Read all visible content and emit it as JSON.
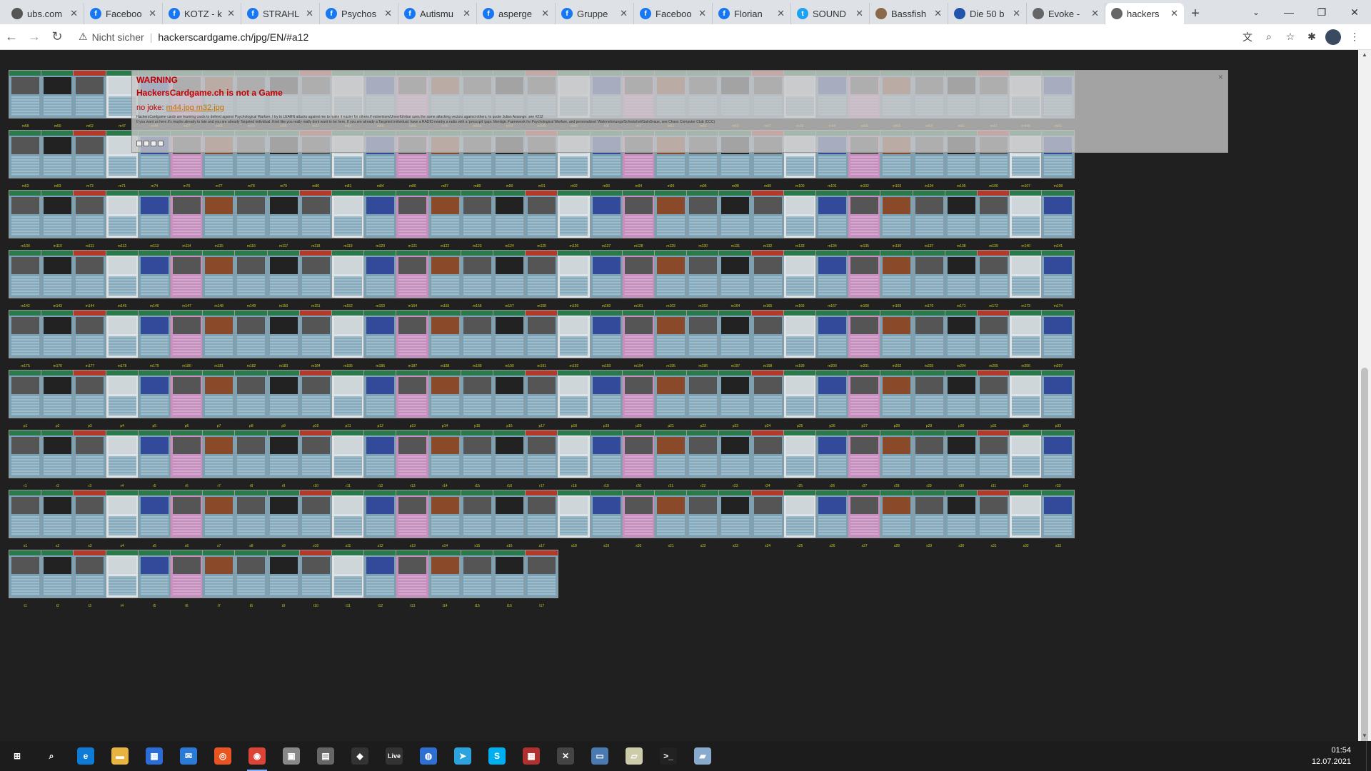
{
  "browser": {
    "tabs": [
      {
        "title": "ubs.com",
        "icon": "ubs-icon",
        "color": "#555555",
        "active": false
      },
      {
        "title": "Faceboo",
        "icon": "facebook-icon",
        "color": "#1877f2",
        "active": false
      },
      {
        "title": "KOTZ - k",
        "icon": "facebook-icon",
        "color": "#1877f2",
        "active": false
      },
      {
        "title": "STRAHL",
        "icon": "facebook-icon",
        "color": "#1877f2",
        "active": false
      },
      {
        "title": "Psychos",
        "icon": "facebook-icon",
        "color": "#1877f2",
        "active": false
      },
      {
        "title": "Autismu",
        "icon": "facebook-icon",
        "color": "#1877f2",
        "active": false
      },
      {
        "title": "asperge",
        "icon": "facebook-icon",
        "color": "#1877f2",
        "active": false
      },
      {
        "title": "Gruppe",
        "icon": "facebook-icon",
        "color": "#1877f2",
        "active": false
      },
      {
        "title": "Faceboo",
        "icon": "facebook-icon",
        "color": "#1877f2",
        "active": false
      },
      {
        "title": "Florian",
        "icon": "facebook-icon",
        "color": "#1877f2",
        "active": false
      },
      {
        "title": "SOUND",
        "icon": "twitter-icon",
        "color": "#1da1f2",
        "active": false
      },
      {
        "title": "Bassfish",
        "icon": "page-icon",
        "color": "#8a6a4a",
        "active": false
      },
      {
        "title": "Die 50 b",
        "icon": "page-icon",
        "color": "#2255aa",
        "active": false
      },
      {
        "title": "Evoke -",
        "icon": "globe-icon",
        "color": "#666666",
        "active": false
      },
      {
        "title": "hackers",
        "icon": "globe-icon",
        "color": "#666666",
        "active": true
      }
    ],
    "new_tab": "+",
    "window_controls": {
      "minimize": "—",
      "maximize": "❐",
      "close": "✕"
    },
    "nav": {
      "back": "←",
      "forward": "→",
      "reload": "↻"
    },
    "address": {
      "security_label": "Nicht sicher",
      "url": "hackerscardgame.ch/jpg/EN/#a12"
    }
  },
  "warning": {
    "title": "WARNING",
    "subtitle": "HackersCardgame.ch is not a Game",
    "joke_prefix": "no joke:",
    "joke_links": "m44.jpg m32.jpg",
    "body_line1": "HackersCardgame cards are learning cards to defend against Psychological Warfare, I try to LEARN attacks against me to make it easier for others if extremism/Unverführbar uses the same attacking vectors against others; to quote Julian Assange: see #212",
    "body_line2": "If you want us here it's maybe already to late and you are already Targeted individual. Kind like you really really dont want to be here. If you are already a Targeted individual: have a RADIO nearby a radio with a 'prescrpit' gapr. Mentigic Framework for Psychological Warfare, and personalized 'Wahrnehmungs/Schwächel/GaloGraue, see Chaos Computer Club (CCC)"
  },
  "card_rows": [
    {
      "labels": [
        "m58",
        "m50",
        "m62",
        "m47",
        "m48",
        "m97",
        "m58",
        "m59",
        "m85",
        "m57",
        "m65",
        "m66",
        "m89",
        "m56",
        "m56b",
        "m34",
        "m34b",
        "m40",
        "m9",
        "m7",
        "m51",
        "m82",
        "m60",
        "m67",
        "m26",
        "m44",
        "m55",
        "m53",
        "m54",
        "m61",
        "m42",
        "m44b",
        "m69"
      ]
    },
    {
      "labels": [
        "m63",
        "m83",
        "m73",
        "m71",
        "m74",
        "m76",
        "m77",
        "m78",
        "m79",
        "m80",
        "m81",
        "m84",
        "m86",
        "m87",
        "m88",
        "m90",
        "m91",
        "m92",
        "m93",
        "m94",
        "m95",
        "m96",
        "m98",
        "m99",
        "m100",
        "m101",
        "m102",
        "m103",
        "m104",
        "m105",
        "m106",
        "m107",
        "m108"
      ]
    },
    {
      "labels": [
        "m109",
        "m110",
        "m111",
        "m112",
        "m113",
        "m114",
        "m115",
        "m116",
        "m117",
        "m118",
        "m119",
        "m120",
        "m121",
        "m122",
        "m123",
        "m124",
        "m125",
        "m126",
        "m127",
        "m128",
        "m129",
        "m130",
        "m131",
        "m132",
        "m133",
        "m134",
        "m135",
        "m136",
        "m137",
        "m138",
        "m139",
        "m140",
        "m141"
      ]
    },
    {
      "labels": [
        "m142",
        "m143",
        "m144",
        "m145",
        "m146",
        "m147",
        "m148",
        "m149",
        "m150",
        "m151",
        "m152",
        "m153",
        "m154",
        "m155",
        "m156",
        "m157",
        "m158",
        "m159",
        "m160",
        "m161",
        "m162",
        "m163",
        "m164",
        "m165",
        "m166",
        "m167",
        "m168",
        "m169",
        "m170",
        "m171",
        "m172",
        "m173",
        "m174"
      ]
    },
    {
      "labels": [
        "m175",
        "m176",
        "m177",
        "m178",
        "m179",
        "m180",
        "m181",
        "m182",
        "m183",
        "m184",
        "m185",
        "m186",
        "m187",
        "m188",
        "m189",
        "m190",
        "m191",
        "m192",
        "m193",
        "m194",
        "m195",
        "m196",
        "m197",
        "m198",
        "m199",
        "m200",
        "m201",
        "m202",
        "m203",
        "m204",
        "m205",
        "m206",
        "m207"
      ]
    },
    {
      "labels": [
        "p1",
        "p2",
        "p3",
        "p4",
        "p5",
        "p6",
        "p7",
        "p8",
        "p9",
        "p10",
        "p11",
        "p12",
        "p13",
        "p14",
        "p15",
        "p16",
        "p17",
        "p18",
        "p19",
        "p20",
        "p21",
        "p22",
        "p23",
        "p24",
        "p25",
        "p26",
        "p27",
        "p28",
        "p29",
        "p30",
        "p31",
        "p32",
        "p33"
      ]
    },
    {
      "labels": [
        "r1",
        "r2",
        "r3",
        "r4",
        "r5",
        "r6",
        "r7",
        "r8",
        "r9",
        "r10",
        "r11",
        "r12",
        "r13",
        "r14",
        "r15",
        "r16",
        "r17",
        "r18",
        "r19",
        "r20",
        "r21",
        "r22",
        "r23",
        "r24",
        "r25",
        "r26",
        "r27",
        "r28",
        "r29",
        "r30",
        "r31",
        "r32",
        "r33"
      ]
    },
    {
      "labels": [
        "s1",
        "s2",
        "s3",
        "s4",
        "s5",
        "s6",
        "s7",
        "s8",
        "s9",
        "s10",
        "s11",
        "s12",
        "s13",
        "s14",
        "s15",
        "s16",
        "s17",
        "s18",
        "s19",
        "s20",
        "s21",
        "s22",
        "s23",
        "s24",
        "s25",
        "s26",
        "s27",
        "s28",
        "s29",
        "s30",
        "s31",
        "s32",
        "s33"
      ]
    },
    {
      "labels": [
        "t1",
        "t2",
        "t3",
        "t4",
        "t5",
        "t6",
        "t7",
        "t8",
        "t9",
        "t10",
        "t11",
        "t12",
        "t13",
        "t14",
        "t15",
        "t16",
        "t17"
      ]
    }
  ],
  "taskbar": {
    "items": [
      {
        "name": "start-icon",
        "glyph": "⊞",
        "color": "#1c1c1c"
      },
      {
        "name": "search-icon",
        "glyph": "⌕",
        "color": "#1c1c1c"
      },
      {
        "name": "edge-icon",
        "glyph": "e",
        "color": "#0f7bd9"
      },
      {
        "name": "file-explorer-icon",
        "glyph": "▬",
        "color": "#e8b341"
      },
      {
        "name": "store-icon",
        "glyph": "▦",
        "color": "#2b6cd6"
      },
      {
        "name": "mail-icon",
        "glyph": "✉",
        "color": "#2a7ad6"
      },
      {
        "name": "ubuntu-icon",
        "glyph": "◎",
        "color": "#e95420"
      },
      {
        "name": "chrome-icon",
        "glyph": "◉",
        "color": "#db4437"
      },
      {
        "name": "app-icon",
        "glyph": "▣",
        "color": "#888888"
      },
      {
        "name": "app-icon",
        "glyph": "▤",
        "color": "#666666"
      },
      {
        "name": "inkscape-icon",
        "glyph": "◆",
        "color": "#333333"
      },
      {
        "name": "live-icon",
        "glyph": "Live",
        "color": "#333333"
      },
      {
        "name": "app-icon",
        "glyph": "◍",
        "color": "#2f6fd1"
      },
      {
        "name": "telegram-icon",
        "glyph": "➤",
        "color": "#2aa3df"
      },
      {
        "name": "skype-icon",
        "glyph": "S",
        "color": "#00aff0"
      },
      {
        "name": "app-icon",
        "glyph": "▦",
        "color": "#b03030"
      },
      {
        "name": "app-icon",
        "glyph": "✕",
        "color": "#444444"
      },
      {
        "name": "app-icon",
        "glyph": "▭",
        "color": "#4a7ab0"
      },
      {
        "name": "app-icon",
        "glyph": "▱",
        "color": "#ccccaa"
      },
      {
        "name": "terminal-icon",
        "glyph": ">_",
        "color": "#222222"
      },
      {
        "name": "app-icon",
        "glyph": "▰",
        "color": "#88aacc"
      }
    ],
    "clock": {
      "time": "01:54",
      "date": "12.07.2021"
    }
  }
}
